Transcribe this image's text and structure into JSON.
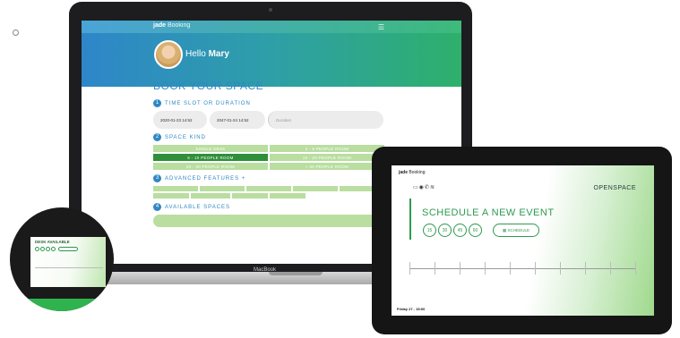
{
  "laptop": {
    "brand_label": "MacBook",
    "app": {
      "logo_brand": "jade",
      "logo_product": "Booking",
      "menu_icon": "hamburger-icon",
      "greeting_prefix": "Hello",
      "user_name": "Mary",
      "title": "BOOK YOUR SPACE",
      "steps": {
        "time": {
          "number": "1",
          "label": "TIME SLOT OR DURATION"
        },
        "kind": {
          "number": "2",
          "label": "SPACE KIND"
        },
        "features": {
          "number": "3",
          "label": "ADVANCED FEATURES +"
        },
        "available": {
          "number": "4",
          "label": "AVAILABLE SPACES"
        }
      },
      "time_start": "2020-01-23 14:52",
      "time_end": "2047-01-24 14:52",
      "duration_placeholder": "Duration",
      "space_kinds": [
        {
          "label": "SINGLE DESK",
          "active": false
        },
        {
          "label": "2 - 5 PEOPLE ROOM",
          "active": false
        },
        {
          "label": "6 - 10 PEOPLE ROOM",
          "active": true
        },
        {
          "label": "10 - 20 PEOPLE ROOM",
          "active": false
        },
        {
          "label": "20 - 30 PEOPLE ROOM",
          "active": false
        },
        {
          "label": "+ 30 PEOPLE ROOM",
          "active": false
        }
      ],
      "features": [
        "",
        "",
        "",
        "",
        "",
        "",
        "",
        "",
        "",
        "",
        ""
      ],
      "available_text": ""
    }
  },
  "tablet": {
    "logo_brand": "jade",
    "logo_product": "Booking",
    "space_name": "OPENSPACE",
    "schedule_title": "SCHEDULE A NEW EVENT",
    "duration_buttons": [
      "15",
      "30",
      "45",
      "60"
    ],
    "schedule_button": "SCHEDULE",
    "date_label": "Friday 27 - 15:00"
  },
  "phone": {
    "status_title": "DESK AVAILABLE"
  },
  "colors": {
    "accent_blue": "#2f88c4",
    "accent_green": "#2e9a50",
    "light_green": "#b9dea0"
  }
}
